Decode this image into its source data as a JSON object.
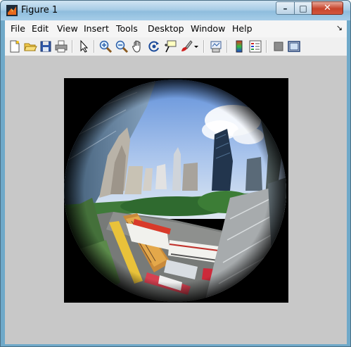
{
  "window": {
    "title": "Figure 1",
    "controls": {
      "minimize": "–",
      "maximize": "□",
      "close": "✕"
    }
  },
  "menubar": {
    "items": [
      "File",
      "Edit",
      "View",
      "Insert",
      "Tools",
      "Desktop",
      "Window",
      "Help"
    ],
    "overflow_arrow": "↘"
  },
  "toolbar": {
    "buttons": [
      {
        "name": "new-figure-icon"
      },
      {
        "name": "open-file-icon"
      },
      {
        "name": "save-icon"
      },
      {
        "name": "print-icon"
      },
      {
        "name": "edit-plot-arrow-icon"
      },
      {
        "name": "zoom-in-icon"
      },
      {
        "name": "zoom-out-icon"
      },
      {
        "name": "pan-hand-icon"
      },
      {
        "name": "rotate-3d-icon"
      },
      {
        "name": "data-cursor-icon"
      },
      {
        "name": "brush-icon"
      },
      {
        "name": "link-plot-icon"
      },
      {
        "name": "colorbar-icon"
      },
      {
        "name": "legend-icon"
      },
      {
        "name": "hide-plot-tools-icon"
      },
      {
        "name": "show-plot-tools-icon"
      }
    ]
  },
  "image": {
    "description_colors": {
      "sky": "#8fb3e6",
      "frame": "#000000",
      "figure_bg": "#c8c8c8"
    }
  }
}
